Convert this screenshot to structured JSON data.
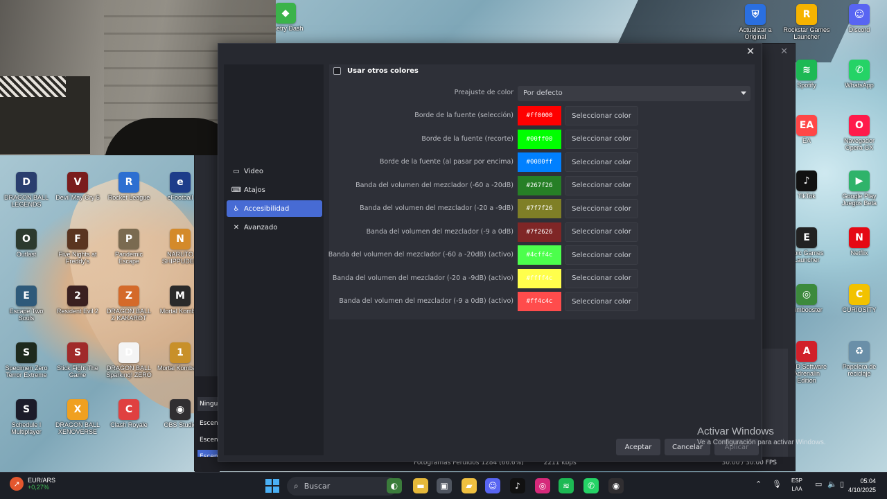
{
  "desktop": {
    "icons_left": [
      {
        "label": "ometry Dash",
        "icon": "geometry-dash-icon",
        "color": "#3bb34a",
        "glyph": "◆"
      },
      {
        "label": "DRAGON BALL LEGENDS",
        "icon": "game-icon",
        "color": "#2a3e6e",
        "glyph": "D"
      },
      {
        "label": "Devil May Cry 5",
        "icon": "game-icon",
        "color": "#7a1c1c",
        "glyph": "V"
      },
      {
        "label": "Rocket League",
        "icon": "game-icon",
        "color": "#2d6fd1",
        "glyph": "R"
      },
      {
        "label": "eFootball",
        "icon": "game-icon",
        "color": "#1d3c8a",
        "glyph": "e"
      },
      {
        "label": "Outlast",
        "icon": "game-icon",
        "color": "#2c3a2e",
        "glyph": "O"
      },
      {
        "label": "Five Nights at Freddy's",
        "icon": "game-icon",
        "color": "#5a3520",
        "glyph": "F"
      },
      {
        "label": "Pandemic Escape",
        "icon": "game-icon",
        "color": "#7a6a50",
        "glyph": "P"
      },
      {
        "label": "NARUTO SHIPPUDEN",
        "icon": "game-icon",
        "color": "#d48a2a",
        "glyph": "N"
      },
      {
        "label": "Escape Two Souls",
        "icon": "game-icon",
        "color": "#2e5a7a",
        "glyph": "E"
      },
      {
        "label": "Resident Evil 2",
        "icon": "game-icon",
        "color": "#3a2020",
        "glyph": "2"
      },
      {
        "label": "DRAGON BALL Z KAKAROT",
        "icon": "game-icon",
        "color": "#d46a2a",
        "glyph": "Z"
      },
      {
        "label": "Mortal Kombat",
        "icon": "game-icon",
        "color": "#2a2a2a",
        "glyph": "M"
      },
      {
        "label": "Specimen Zero Terror Extreme",
        "icon": "game-icon",
        "color": "#1e2a1e",
        "glyph": "S"
      },
      {
        "label": "Stick Fight The Game",
        "icon": "game-icon",
        "color": "#a02a2a",
        "glyph": "S"
      },
      {
        "label": "DRAGON BALL Sparking! ZERO",
        "icon": "game-icon",
        "color": "#f4f4f4",
        "glyph": "D"
      },
      {
        "label": "Mortal Kombat 1",
        "icon": "game-icon",
        "color": "#c8902a",
        "glyph": "1"
      },
      {
        "label": "Schedule I Multiplayer",
        "icon": "game-icon",
        "color": "#1c1c2a",
        "glyph": "S"
      },
      {
        "label": "DRAGON BALL XENOVERSE",
        "icon": "game-icon",
        "color": "#f0a020",
        "glyph": "X"
      },
      {
        "label": "Clash Royale",
        "icon": "game-icon",
        "color": "#e04040",
        "glyph": "C"
      },
      {
        "label": "OBS Studio",
        "icon": "obs-icon",
        "color": "#302e31",
        "glyph": "◉"
      }
    ],
    "icons_right": [
      {
        "label": "Actualizar a Original",
        "icon": "shield-icon",
        "color": "#2a6fe0",
        "glyph": "⛨"
      },
      {
        "label": "Rockstar Games Launcher",
        "icon": "rockstar-icon",
        "color": "#f6b300",
        "glyph": "R"
      },
      {
        "label": "Discord",
        "icon": "discord-icon",
        "color": "#5865f2",
        "glyph": "☺"
      },
      {
        "label": "Spotify",
        "icon": "spotify-icon",
        "color": "#1db954",
        "glyph": "≋"
      },
      {
        "label": "WhatsApp",
        "icon": "whatsapp-icon",
        "color": "#25d366",
        "glyph": "✆"
      },
      {
        "label": "EA",
        "icon": "ea-icon",
        "color": "#ff4747",
        "glyph": "EA"
      },
      {
        "label": "Navegador Opera GX",
        "icon": "opera-icon",
        "color": "#ff1b4b",
        "glyph": "O"
      },
      {
        "label": "TikTok",
        "icon": "tiktok-icon",
        "color": "#111111",
        "glyph": "♪"
      },
      {
        "label": "Google Play Juegos Beta",
        "icon": "google-play-icon",
        "color": "#2fb36a",
        "glyph": "▶"
      },
      {
        "label": "Epic Games Launcher",
        "icon": "epic-icon",
        "color": "#222222",
        "glyph": "E"
      },
      {
        "label": "Netflix",
        "icon": "netflix-icon",
        "color": "#e50914",
        "glyph": "N"
      },
      {
        "label": "Aimbooster",
        "icon": "aim-icon",
        "color": "#3c8a3c",
        "glyph": "◎"
      },
      {
        "label": "CURIOSITY",
        "icon": "app-icon",
        "color": "#f2c200",
        "glyph": "C"
      },
      {
        "label": "AMD Software Adrenalin Edition",
        "icon": "amd-icon",
        "color": "#d1202a",
        "glyph": "A"
      },
      {
        "label": "Papelera de reciclaje",
        "icon": "recycle-bin-icon",
        "color": "#6a8fa8",
        "glyph": "♻"
      }
    ]
  },
  "obs_background": {
    "scene_items": [
      "Ningu",
      "Escen",
      "Escen",
      "Escen"
    ],
    "status_left": "Fotogramas Perdidos 1284 (66.6%)",
    "status_mid": "2211 kbps",
    "status_right": "30.00 / 30.00 FPS"
  },
  "dialog": {
    "close_glyph": "✕",
    "nav": [
      {
        "label": "Video",
        "icon": "monitor-icon",
        "glyph": "▭",
        "active": false
      },
      {
        "label": "Atajos",
        "icon": "keyboard-icon",
        "glyph": "⌨",
        "active": false
      },
      {
        "label": "Accesibilidad",
        "icon": "accessibility-icon",
        "glyph": "♿",
        "active": true
      },
      {
        "label": "Avanzado",
        "icon": "wrench-icon",
        "glyph": "✕",
        "active": false
      }
    ],
    "use_other_colors": "Usar otros colores",
    "preset_label": "Preajuste de color",
    "preset_value": "Por defecto",
    "pick_label": "Seleccionar color",
    "colors": [
      {
        "label": "Borde de la fuente (selección)",
        "hex": "#ff0000",
        "code": "#ff0000"
      },
      {
        "label": "Borde de la fuente (recorte)",
        "hex": "#00ff00",
        "code": "#00ff00"
      },
      {
        "label": "Borde de la fuente (al pasar por encima)",
        "hex": "#0080ff",
        "code": "#0080ff"
      },
      {
        "label": "Banda del volumen del mezclador (-60 a -20dB)",
        "hex": "#267f26",
        "code": "#267f26"
      },
      {
        "label": "Banda del volumen del mezclador (-20 a -9dB)",
        "hex": "#7f7f26",
        "code": "#7f7f26"
      },
      {
        "label": "Banda del volumen del mezclador (-9 a 0dB)",
        "hex": "#7f2626",
        "code": "#7f2626"
      },
      {
        "label": "Banda del volumen del mezclador (-60 a -20dB) (activo)",
        "hex": "#4cff4c",
        "code": "#4cff4c"
      },
      {
        "label": "Banda del volumen del mezclador (-20 a -9dB) (activo)",
        "hex": "#ffff4c",
        "code": "#ffff4c"
      },
      {
        "label": "Banda del volumen del mezclador (-9 a 0dB) (activo)",
        "hex": "#ff4c4c",
        "code": "#ff4c4c"
      }
    ],
    "buttons": {
      "accept": "Aceptar",
      "cancel": "Cancelar",
      "apply": "Aplicar"
    }
  },
  "watermark": {
    "title": "Activar Windows",
    "subtitle": "Ve a Configuración para activar Windows."
  },
  "taskbar": {
    "ticker_name": "EUR/ARS",
    "ticker_value": "+0,27%",
    "search_placeholder": "Buscar",
    "apps": [
      {
        "icon": "widgets-icon",
        "color": "#3b7c3b",
        "glyph": "◐"
      },
      {
        "icon": "file-explorer-icon",
        "color": "#e6b93a",
        "glyph": "▬"
      },
      {
        "icon": "store-icon",
        "color": "#4f5560",
        "glyph": "▣"
      },
      {
        "icon": "folder-icon",
        "color": "#f0c040",
        "glyph": "▰"
      },
      {
        "icon": "discord-icon",
        "color": "#5865f2",
        "glyph": "☺"
      },
      {
        "icon": "tiktok-icon",
        "color": "#111111",
        "glyph": "♪"
      },
      {
        "icon": "instagram-icon",
        "color": "#d6297a",
        "glyph": "◎"
      },
      {
        "icon": "spotify-icon",
        "color": "#1db954",
        "glyph": "≋"
      },
      {
        "icon": "whatsapp-icon",
        "color": "#25d366",
        "glyph": "✆"
      },
      {
        "icon": "obs-icon",
        "color": "#302e31",
        "glyph": "◉"
      }
    ],
    "lang_top": "ESP",
    "lang_bottom": "LAA",
    "time": "05:04",
    "date": "4/10/2025"
  }
}
